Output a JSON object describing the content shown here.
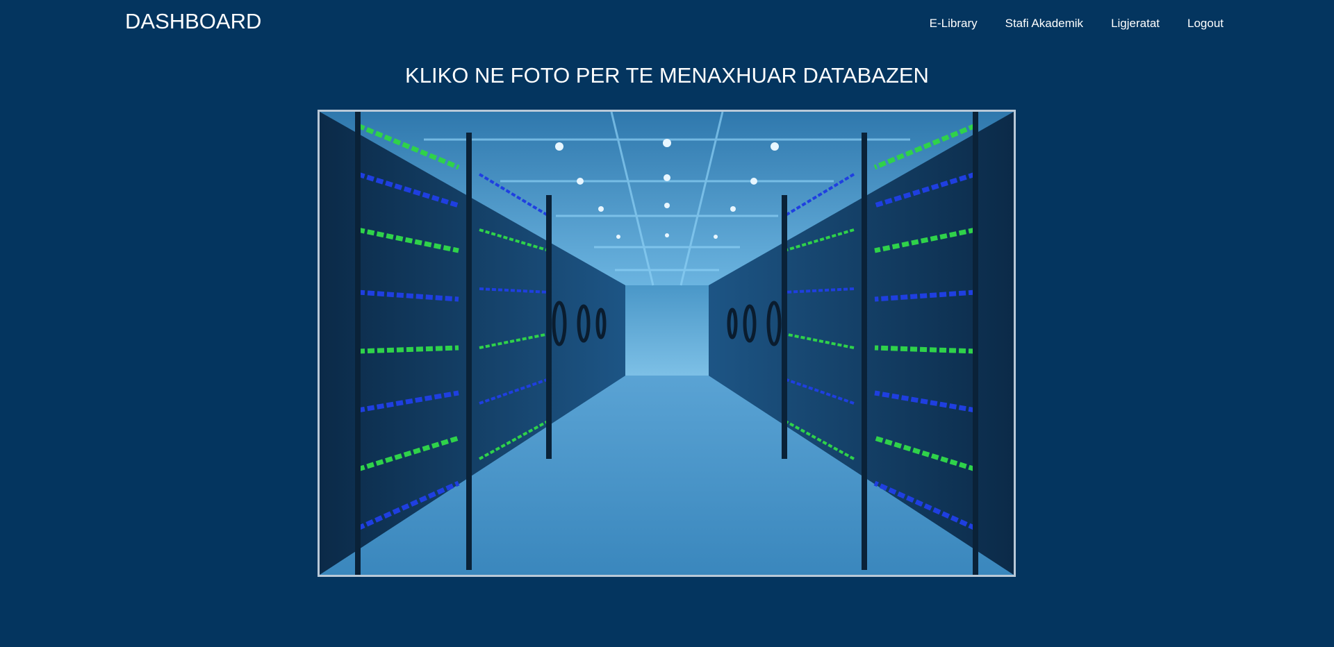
{
  "navbar": {
    "brand": "DASHBOARD",
    "links": [
      "E-Library",
      "Stafi Akademik",
      "Ligjeratat",
      "Logout"
    ]
  },
  "main": {
    "heading": "KLIKO NE FOTO PER TE MENAXHUAR DATABAZEN",
    "photo": {
      "subject": "server room data center corridor",
      "icon": "database-photo"
    }
  },
  "colors": {
    "background": "#04355f",
    "text": "#ffffff",
    "photo_border": "#b9c9d8",
    "rack_led_green": "#2fd24a",
    "rack_led_blue": "#1f3fe0"
  }
}
